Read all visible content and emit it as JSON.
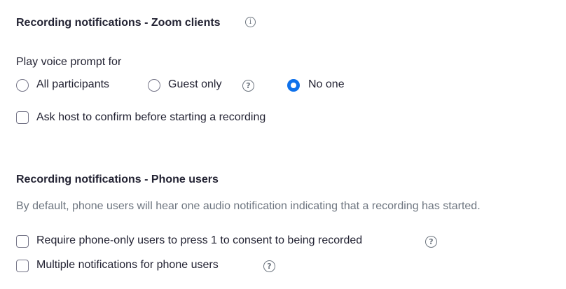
{
  "zoom_clients": {
    "title": "Recording notifications - Zoom clients",
    "voice_prompt_label": "Play voice prompt for",
    "options": [
      {
        "label": "All participants",
        "checked": false
      },
      {
        "label": "Guest only",
        "checked": false
      },
      {
        "label": "No one",
        "checked": true
      }
    ],
    "confirm_checkbox_label": "Ask host to confirm before starting a recording",
    "confirm_checked": false
  },
  "phone_users": {
    "title": "Recording notifications - Phone users",
    "description": "By default, phone users will hear one audio notification indicating that a recording has started.",
    "consent_label": "Require phone-only users to press 1 to consent to being recorded",
    "consent_checked": false,
    "multiple_label": "Multiple notifications for phone users",
    "multiple_checked": false
  },
  "icons": {
    "info": "info-icon",
    "help": "help-icon"
  },
  "colors": {
    "accent": "#0e71eb",
    "text": "#232333",
    "muted": "#6e7680"
  }
}
